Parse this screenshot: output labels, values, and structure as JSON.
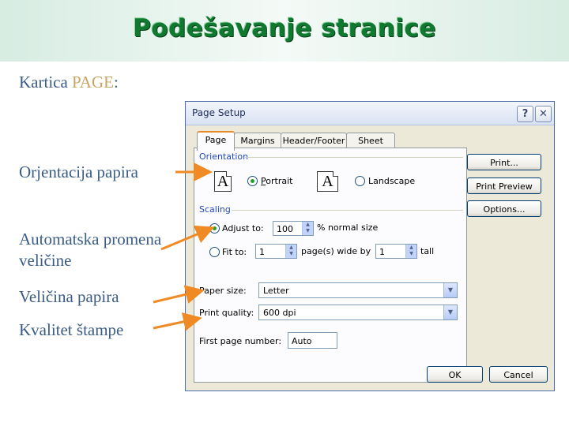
{
  "slide": {
    "title": "Podešavanje stranice",
    "subtitle_prefix": "Kartica ",
    "subtitle_highlight": "PAGE",
    "subtitle_suffix": ":",
    "labels": {
      "orientation": "Orjentacija papira",
      "auto_scale": "Automatska promena veličine",
      "paper_size": "Veličina papira",
      "print_quality": "Kvalitet štampe"
    },
    "colors": {
      "title": "#0f7a2f",
      "label": "#3a5c86",
      "highlight": "#c8a45e",
      "arrow": "#f08a24"
    }
  },
  "dialog": {
    "title": "Page Setup",
    "help_button": "?",
    "close_button": "✕",
    "tabs": [
      "Page",
      "Margins",
      "Header/Footer",
      "Sheet"
    ],
    "active_tab": "Page",
    "orientation": {
      "group_label": "Orientation",
      "portrait_label": "Portrait",
      "landscape_label": "Landscape",
      "icon_letter": "A",
      "selected": "Portrait"
    },
    "scaling": {
      "group_label": "Scaling",
      "adjust_to_label": "Adjust to:",
      "adjust_to_value": "100",
      "percent_label": "% normal size",
      "fit_to_label": "Fit to:",
      "pages_wide_value": "1",
      "pages_wide_label": "page(s) wide by",
      "pages_tall_value": "1",
      "tall_label": "tall",
      "selected": "Adjust to"
    },
    "paper_size_label": "Paper size:",
    "paper_size_value": "Letter",
    "print_quality_label": "Print quality:",
    "print_quality_value": "600 dpi",
    "first_page_label": "First page number:",
    "first_page_value": "Auto",
    "buttons": {
      "print": "Print...",
      "print_preview": "Print Preview",
      "options": "Options...",
      "ok": "OK",
      "cancel": "Cancel"
    }
  }
}
